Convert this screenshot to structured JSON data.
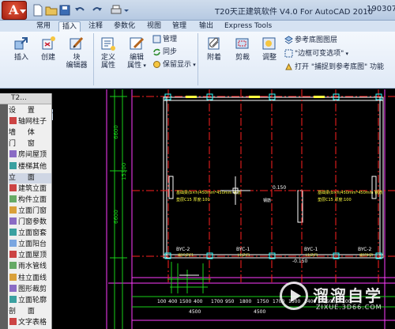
{
  "window": {
    "title": "T20天正建筑软件 V4.0 For AutoCAD 2010",
    "title_right": "190307"
  },
  "tabs": [
    "常用",
    "插入",
    "注释",
    "参数化",
    "视图",
    "管理",
    "输出",
    "Express Tools"
  ],
  "active_tab": "插入",
  "ribbon": {
    "block": {
      "insert": "插入",
      "create": "创建",
      "block_editor_1": "块",
      "block_editor_2": "编辑器"
    },
    "attributes": {
      "define_1": "定义",
      "define_2": "属性",
      "edit_1": "编辑",
      "edit_2": "属性",
      "manage": "管理",
      "sync": "同步",
      "retain": "保留显示"
    },
    "reference": {
      "attach": "附着",
      "clip": "剪裁",
      "adjust": "调整",
      "underlay_layers": "参考底图图层",
      "frame_variable": "\"边框可变选项\"",
      "snap_underlay": "打开 \"捕捉到参考底图\" 功能"
    },
    "panels": {
      "block": "块",
      "attributes": "属性",
      "reference": "参照"
    }
  },
  "palette": {
    "title": "T2...",
    "items": [
      {
        "label": "设 置",
        "spaced": true
      },
      {
        "label": "轴网柱子",
        "spaced": false
      },
      {
        "label": "墙 体",
        "spaced": true
      },
      {
        "label": "门 窗",
        "spaced": true
      },
      {
        "label": "房间屋顶",
        "spaced": false
      },
      {
        "label": "楼梯其他",
        "spaced": false
      },
      {
        "label": "立 面",
        "spaced": true,
        "selected": true
      },
      {
        "label": "建筑立面",
        "spaced": false
      },
      {
        "label": "构件立面",
        "spaced": false
      },
      {
        "label": "立面门窗",
        "spaced": false
      },
      {
        "label": "门窗参数",
        "spaced": false
      },
      {
        "label": "立面窗套",
        "spaced": false
      },
      {
        "label": "立面阳台",
        "spaced": false
      },
      {
        "label": "立面屋顶",
        "spaced": false
      },
      {
        "label": "雨水管线",
        "spaced": false
      },
      {
        "label": "柱立面线",
        "spaced": false
      },
      {
        "label": "图形裁剪",
        "spaced": false
      },
      {
        "label": "立面轮廓",
        "spaced": false
      },
      {
        "label": "剖 面",
        "spaced": true
      },
      {
        "label": "文字表格",
        "spaced": false
      }
    ]
  },
  "drawing": {
    "left_dims": [
      "6600",
      "15300",
      "6600"
    ],
    "elev_right": "0.150",
    "elev_bottom": "-0.150",
    "beam_labels": [
      "BYC-2",
      "BYC-1",
      "BYC-1",
      "BYC-2"
    ],
    "beam_notes": [
      "墙1C(Z)F1",
      "L1(Z)F1",
      "L1(Z)F1",
      "墙1F0(Z)"
    ],
    "beam_text_left": "基础梁(b×h)450mm*450mm 钢筋",
    "beam_text_right": "基础梁(b×h)450mm*450mm 钢筋",
    "sub_text_left": "垫层C15 厚度:100",
    "sub_text_right": "垫层C15 厚度:100",
    "center_label": "钢筋",
    "dims_row1": [
      "100",
      "400",
      "1500",
      "400",
      "1700",
      "950",
      "1800",
      "1750",
      "1700",
      "1500",
      "1400",
      "1500",
      "100"
    ],
    "dims_row2": [
      "4500",
      "4500"
    ]
  },
  "watermark": {
    "main": "溜溜自学",
    "sub": "ZIXUE.3D66.COM"
  },
  "colors": {
    "cad_background": "#000000",
    "axis_red": "#ff2020",
    "dim_green": "#19d019",
    "wall_white": "#ffffff",
    "magenta": "#ff3cff",
    "yellow": "#ffff40",
    "cyan": "#30ffff",
    "ribbon_blue": "#dfe9f6"
  }
}
